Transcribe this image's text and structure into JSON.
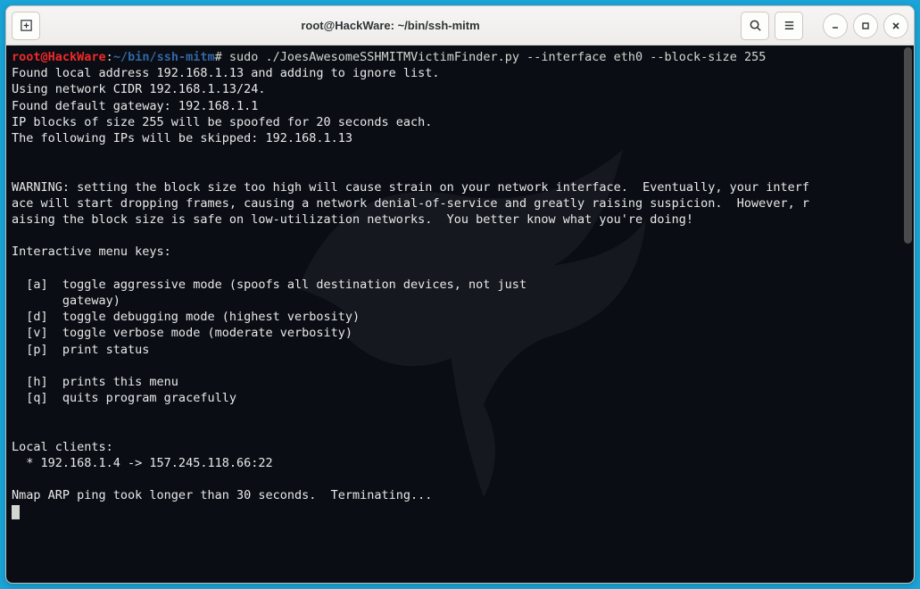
{
  "title": "root@HackWare: ~/bin/ssh-mitm",
  "prompt": {
    "user": "root@HackWare",
    "colon": ":",
    "path": "~/bin/ssh-mitm",
    "hash": "#",
    "command": " sudo ./JoesAwesomeSSHMITMVictimFinder.py --interface eth0 --block-size 255"
  },
  "lines": {
    "l1": "Found local address 192.168.1.13 and adding to ignore list.",
    "l2": "Using network CIDR 192.168.1.13/24.",
    "l3": "Found default gateway: 192.168.1.1",
    "l4": "IP blocks of size 255 will be spoofed for 20 seconds each.",
    "l5": "The following IPs will be skipped: 192.168.1.13",
    "blank1": "",
    "blank2": "",
    "w1": "WARNING: setting the block size too high will cause strain on your network interface.  Eventually, your interf",
    "w2": "ace will start dropping frames, causing a network denial-of-service and greatly raising suspicion.  However, r",
    "w3": "aising the block size is safe on low-utilization networks.  You better know what you're doing!",
    "blank3": "",
    "menu_h": "Interactive menu keys:",
    "blank4": "",
    "ka": "  [a]  toggle aggressive mode (spoofs all destination devices, not just",
    "ka2": "       gateway)",
    "kd": "  [d]  toggle debugging mode (highest verbosity)",
    "kv": "  [v]  toggle verbose mode (moderate verbosity)",
    "kp": "  [p]  print status",
    "blank5": "",
    "kh": "  [h]  prints this menu",
    "kq": "  [q]  quits program gracefully",
    "blank6": "",
    "blank7": "",
    "lc_h": "Local clients:",
    "lc1": "  * 192.168.1.4 -> 157.245.118.66:22",
    "blank8": "",
    "nmap": "Nmap ARP ping took longer than 30 seconds.  Terminating..."
  }
}
